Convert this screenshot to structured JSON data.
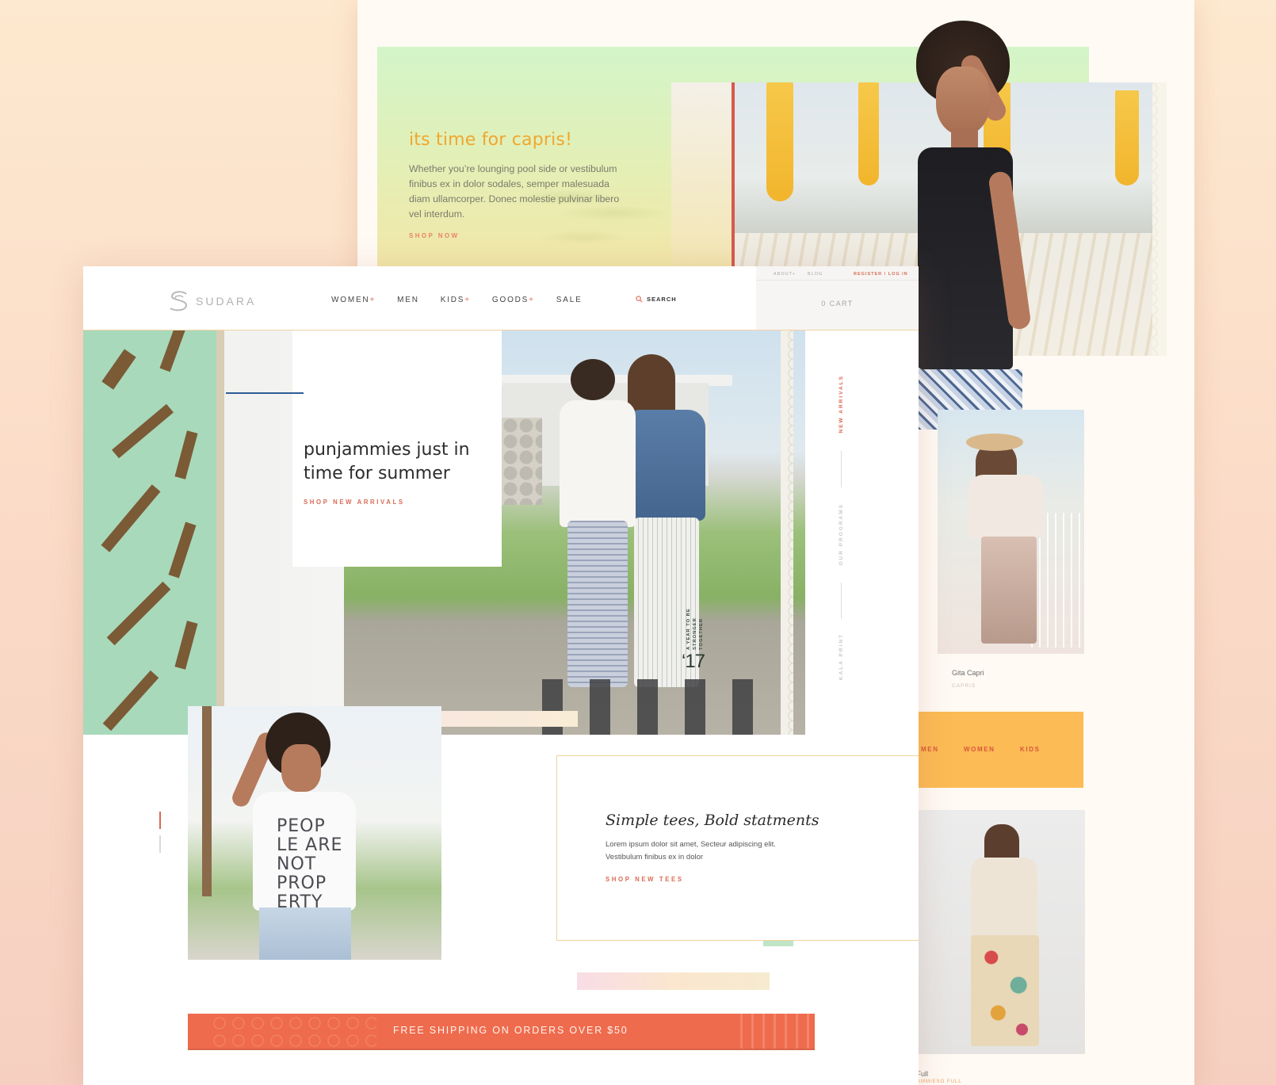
{
  "back_page": {
    "capri": {
      "title": "its time for capris!",
      "body": "Whether you’re lounging pool side or vestibulum finibus ex in dolor sodales, semper malesuada diam ullamcorper. Donec molestie pulvinar libero vel interdum.",
      "shop_label": "SHOP NOW"
    },
    "product_1": {
      "name": "Gita Capri",
      "category": "CAPRIS"
    },
    "category_bar": {
      "items": [
        "MEN",
        "WOMEN",
        "KIDS"
      ]
    },
    "product_2": {
      "name": "a Full",
      "category": "AMMIESO FULL"
    }
  },
  "header": {
    "logo_text": "SUDARA",
    "nav": [
      {
        "label": "WOMEN",
        "has_plus": "+"
      },
      {
        "label": "MEN",
        "has_plus": ""
      },
      {
        "label": "KIDS",
        "has_plus": "+"
      },
      {
        "label": "GOODS",
        "has_plus": "+"
      },
      {
        "label": "SALE",
        "has_plus": ""
      }
    ],
    "search_label": "SEARCH",
    "util": {
      "about": "ABOUT+",
      "blog": "BLOG",
      "register": "REGISTER / LOG IN"
    },
    "cart": "0 CART"
  },
  "hero": {
    "title": "punjammies just in time for summer",
    "shop_label": "SHOP NEW ARRIVALS",
    "year_caption": "A YEAR TO BE STRONGER TOGETHER",
    "year": "‘17",
    "side_rail": [
      "NEW ARRIVALS",
      "OUR PROGRAMS",
      "KALA PRINT"
    ]
  },
  "tees": {
    "shirt_print": "PEOP LE ARE NOT PROP ERTY",
    "title": "Simple tees, Bold statments",
    "body": "Lorem ipsum dolor sit amet, Secteur adipiscing elit. Vestibulum finibus ex in dolor",
    "shop_label": "SHOP NEW TEES"
  },
  "shipping_banner": "FREE SHIPPING ON ORDERS OVER $50",
  "colors": {
    "accent_coral": "#d86b55",
    "capri_orange": "#f0a72f",
    "category_yellow": "#fcbb55",
    "banner_red": "#ef6b4d",
    "hero_blue": "#2e5d96",
    "tag_green": "#bfe4c6"
  }
}
